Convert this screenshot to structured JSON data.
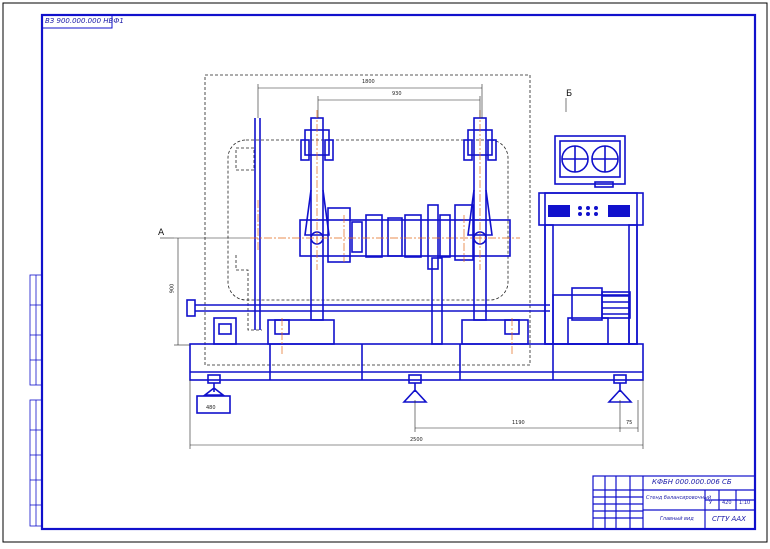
{
  "sheet": {
    "stamp_code": "ВЗ 900.000.000 НВФ1",
    "view_a": "А",
    "view_b": "Б"
  },
  "dimensions": {
    "top_span": "1800",
    "top_inner": "930",
    "height": "900",
    "base_right": "1190",
    "right_offset": "75",
    "overall": "2500",
    "block": "480"
  },
  "title_block": {
    "doc_code": "КФБН 000.000.006 СБ",
    "name": "Стенд балансировочный",
    "subtitle": "Главный вид",
    "letter": "У",
    "mass": "420",
    "scale": "1:10",
    "org": "СГТУ ААХ"
  },
  "colors": {
    "line": "#1111cc",
    "border": "#000000",
    "center": "#e36a1a",
    "dash": "#222222"
  }
}
